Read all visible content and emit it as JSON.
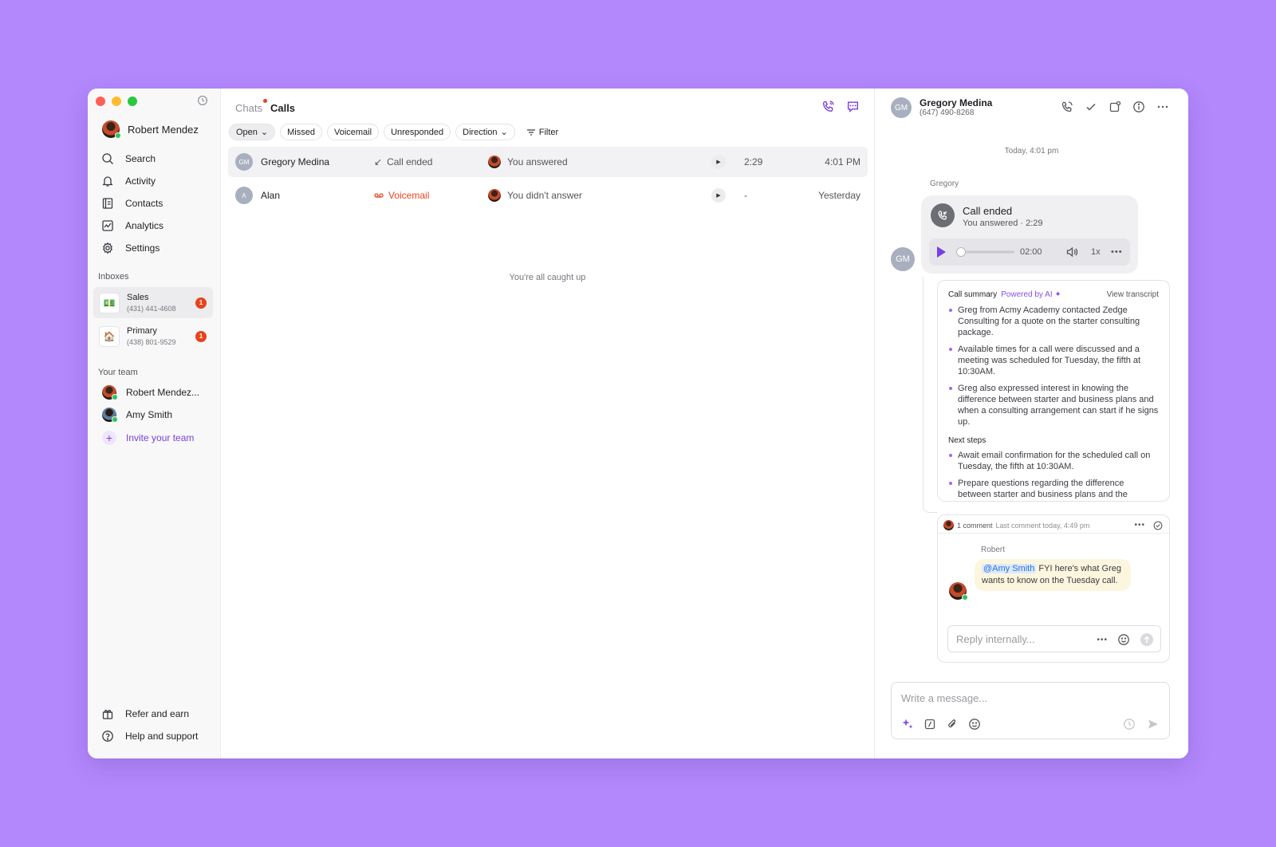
{
  "colors": {
    "background": "#b388fc",
    "accent": "#7a3fe0",
    "badge": "#e8431c",
    "online": "#2fc45a"
  },
  "sidebar": {
    "user_name": "Robert Mendez",
    "nav": [
      {
        "label": "Search",
        "icon": "search-icon"
      },
      {
        "label": "Activity",
        "icon": "bell-icon"
      },
      {
        "label": "Contacts",
        "icon": "contacts-icon"
      },
      {
        "label": "Analytics",
        "icon": "analytics-icon"
      },
      {
        "label": "Settings",
        "icon": "gear-icon"
      }
    ],
    "inboxes_label": "Inboxes",
    "inboxes": [
      {
        "name": "Sales",
        "number": "(431) 441-4608",
        "badge": "1"
      },
      {
        "name": "Primary",
        "number": "(438) 801-9529",
        "badge": "1"
      }
    ],
    "team_label": "Your team",
    "team": [
      {
        "name": "Robert Mendez..."
      },
      {
        "name": "Amy Smith"
      }
    ],
    "invite_label": "Invite your team",
    "refer_label": "Refer and earn",
    "help_label": "Help and support"
  },
  "middle": {
    "tab_chats": "Chats",
    "tab_calls": "Calls",
    "filters": [
      "Open",
      "Missed",
      "Voicemail",
      "Unresponded",
      "Direction",
      "Filter"
    ],
    "calls": [
      {
        "initials": "GM",
        "name": "Gregory Medina",
        "status": "Call ended",
        "answer": "You answered",
        "duration": "2:29",
        "time": "4:01 PM"
      },
      {
        "initials": "A",
        "name": "Alan",
        "status": "Voicemail",
        "answer": "You didn't answer",
        "duration": "-",
        "time": "Yesterday"
      }
    ],
    "empty_text": "You're all caught up"
  },
  "detail": {
    "contact_initials": "GM",
    "contact_name": "Gregory Medina",
    "contact_phone": "(647) 490-8268",
    "day_label": "Today, 4:01 pm",
    "sender": "Gregory",
    "call_title": "Call ended",
    "call_sub": "You answered · 2:29",
    "player_time": "02:00",
    "player_speed": "1x",
    "progress": 0.0,
    "summary_title": "Call summary",
    "summary_ai": "Powered by AI ✦",
    "summary_link": "View transcript",
    "summary_points": [
      "Greg from Acmy Academy contacted Zedge Consulting for a quote on the starter consulting package.",
      "Available times for a call were discussed and a meeting was scheduled for Tuesday, the fifth at 10:30AM.",
      "Greg also expressed interest in knowing the difference between starter and business plans and when a consulting arrangement can start if he signs up."
    ],
    "next_steps_title": "Next steps",
    "next_steps": [
      "Await email confirmation for the scheduled call on Tuesday, the fifth at 10:30AM.",
      "Prepare questions regarding the difference between starter and business plans and the"
    ],
    "comment_count": "1 comment",
    "comment_last": "Last comment today, 4:49 pm",
    "comment_author": "Robert",
    "comment_mention": "@Amy Smith",
    "comment_text": " FYI here's what Greg wants to know on the Tuesday call.",
    "reply_placeholder": "Reply internally...",
    "compose_placeholder": "Write a message..."
  }
}
